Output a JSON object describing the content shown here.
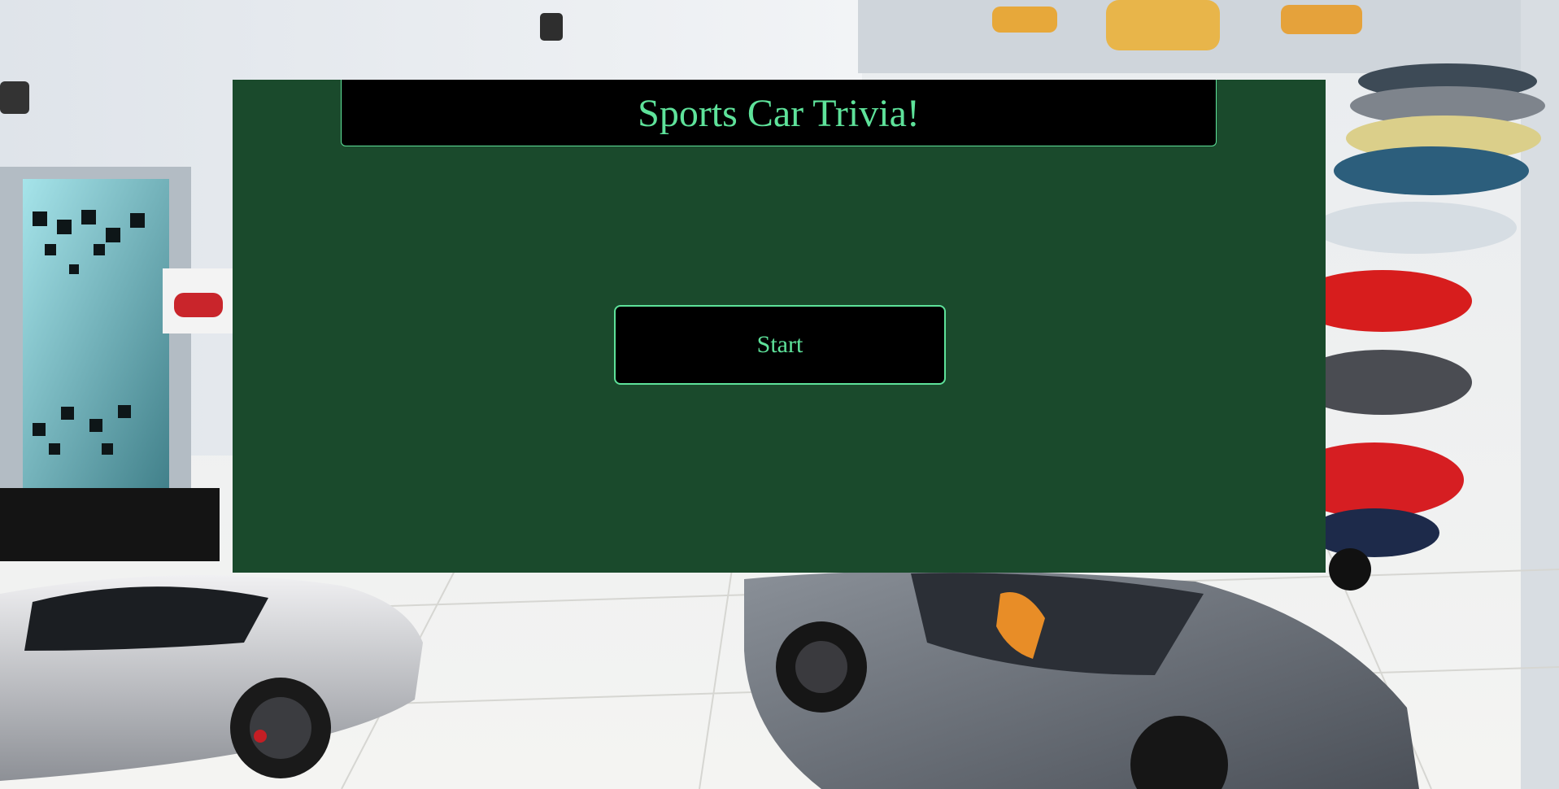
{
  "page": {
    "title": "Sports Car Trivia!"
  },
  "start_button": {
    "label": "Start"
  },
  "background": {
    "subject": "car-showroom-photo",
    "cars": [
      "silver-hypercar",
      "grey-supercar",
      "yellow-racer",
      "blue-convertible",
      "white-coupe",
      "red-sports-car",
      "black-roadster",
      "red-blue-hypercar"
    ]
  },
  "colors": {
    "panel": "#1a4a2c",
    "accent": "#5ee29a",
    "button_bg": "#000000"
  }
}
